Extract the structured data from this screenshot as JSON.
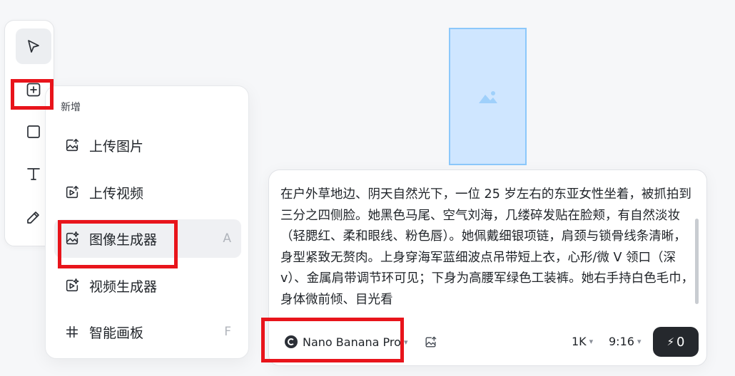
{
  "menu": {
    "title": "新增",
    "items": [
      {
        "label": "上传图片",
        "shortcut": ""
      },
      {
        "label": "上传视频",
        "shortcut": ""
      },
      {
        "label": "图像生成器",
        "shortcut": "A"
      },
      {
        "label": "视频生成器",
        "shortcut": ""
      },
      {
        "label": "智能画板",
        "shortcut": "F"
      }
    ]
  },
  "prompt": {
    "text": "在户外草地边、阴天自然光下，一位 25 岁左右的东亚女性坐着，被抓拍到三分之四侧脸。她黑色马尾、空气刘海，几缕碎发贴在脸颊，有自然淡妆（轻腮红、柔和眼线、粉色唇）。她佩戴细银项链，肩颈与锁骨线条清晰，身型紧致无赘肉。上身穿海军蓝细波点吊带短上衣，心形/微 V 领口（深 v）、金属肩带调节环可见；下身为高腰军绿色工装裤。她右手持白色毛巾，身体微前倾、目光看",
    "model": "Nano Banana Pro",
    "resolution": "1K",
    "aspect_ratio": "9:16",
    "send_count": "0"
  },
  "colors": {
    "highlight": "#e8141b",
    "placeholder_fill": "#cfe6ff",
    "send_bg": "#25282d"
  }
}
